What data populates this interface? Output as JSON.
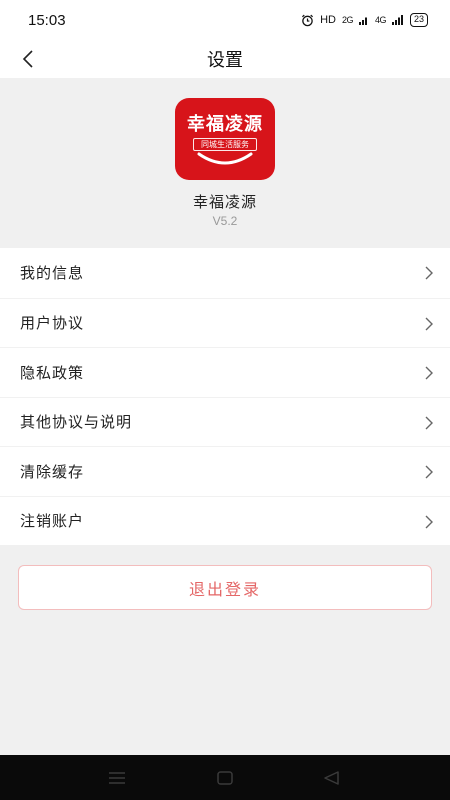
{
  "status_bar": {
    "time": "15:03",
    "network": "HD",
    "signal_1": "2G",
    "signal_2": "4G",
    "battery": "23",
    "alarm_icon": "alarm-clock-icon"
  },
  "nav": {
    "title": "设置",
    "back_icon": "chevron-left-icon"
  },
  "app": {
    "logo_title": "幸福凌源",
    "logo_subtitle": "同城生活服务",
    "name": "幸福凌源",
    "version": "V5.2",
    "brand_color": "#d7141a"
  },
  "menu": {
    "items": [
      {
        "label": "我的信息"
      },
      {
        "label": "用户协议"
      },
      {
        "label": "隐私政策"
      },
      {
        "label": "其他协议与说明"
      },
      {
        "label": "清除缓存"
      },
      {
        "label": "注销账户"
      }
    ],
    "chevron_icon": "chevron-right-icon"
  },
  "logout": {
    "label": "退出登录",
    "color": "#e46767"
  },
  "system_nav": {
    "icons": [
      "menu-icon",
      "home-icon",
      "back-triangle-icon"
    ]
  }
}
